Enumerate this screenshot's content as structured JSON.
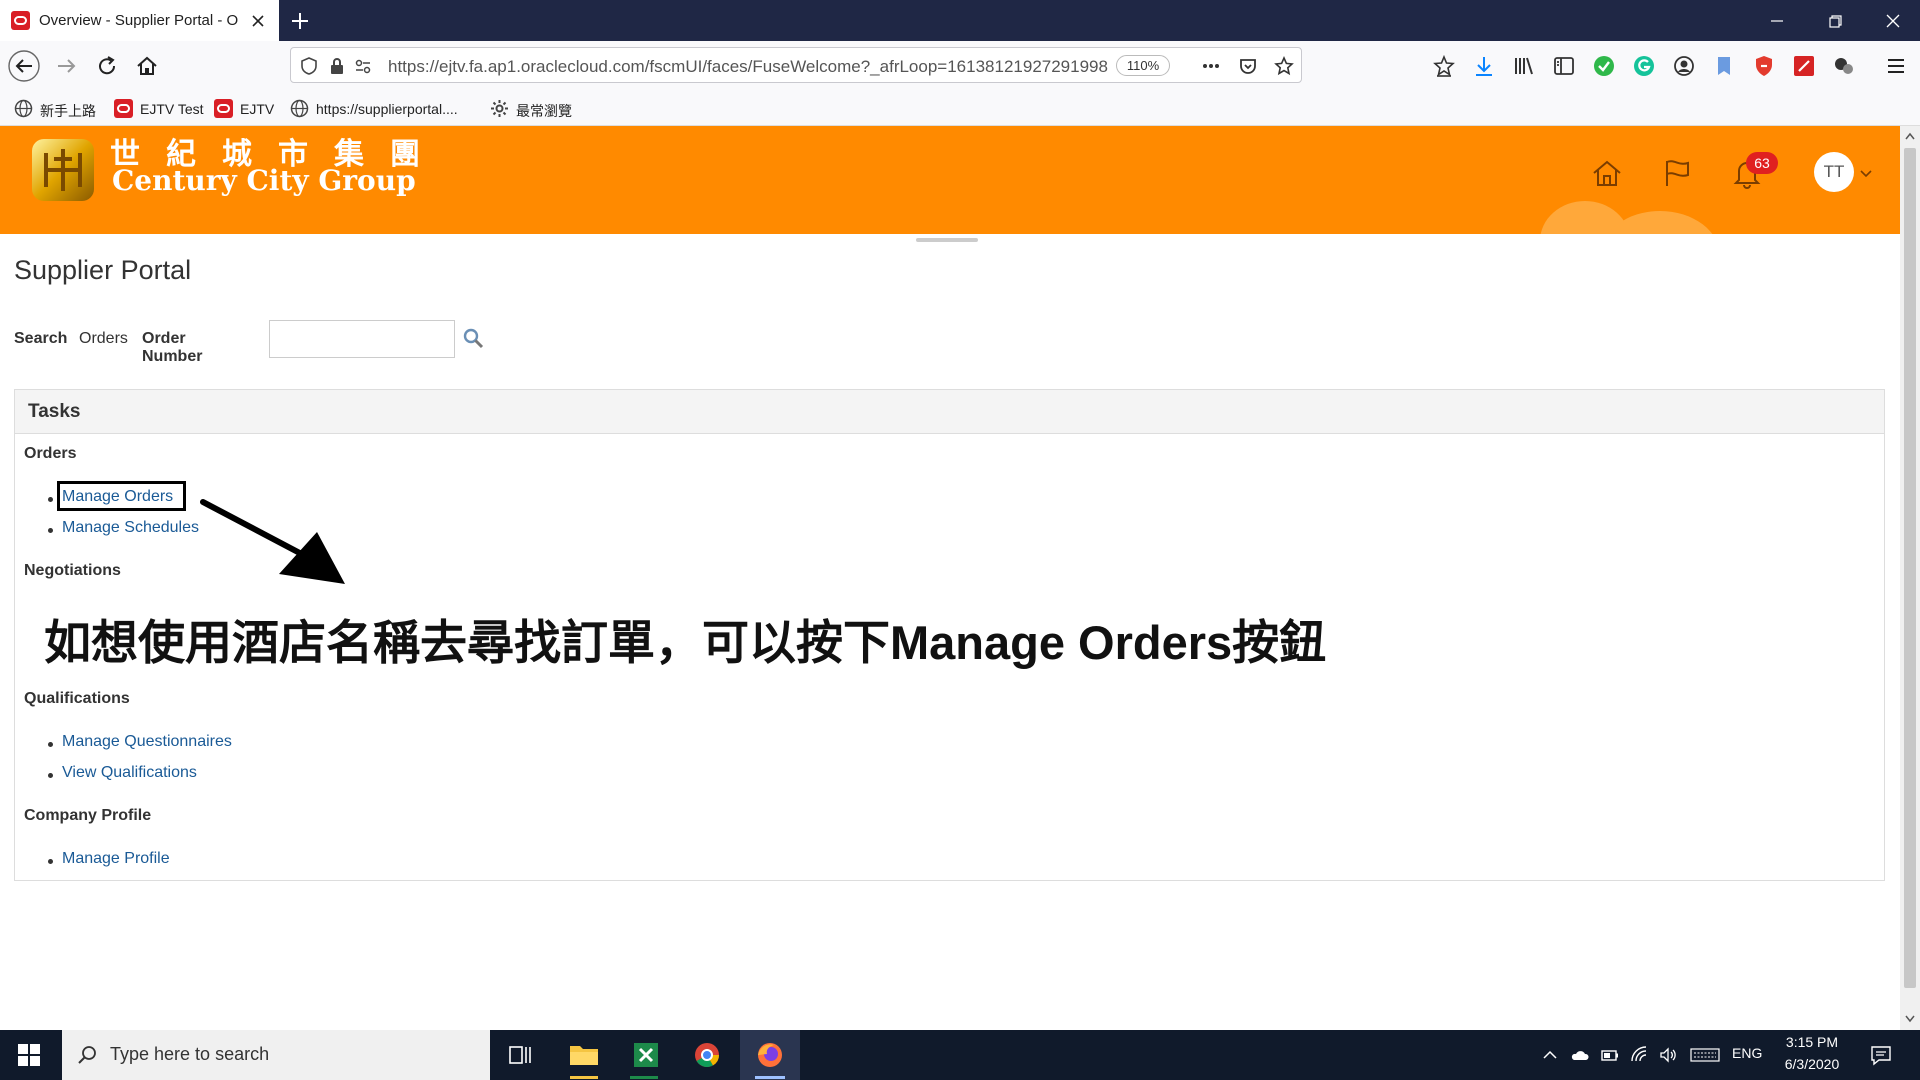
{
  "browser": {
    "tab_title": "Overview - Supplier Portal - Or",
    "url": "https://ejtv.fa.ap1.oraclecloud.com/fscmUI/faces/FuseWelcome?_afrLoop=16138121927291998",
    "zoom": "110%",
    "bookmarks": [
      {
        "label": "新手上路",
        "icon": "globe-icon"
      },
      {
        "label": "EJTV Test",
        "icon": "oracle-icon"
      },
      {
        "label": "EJTV",
        "icon": "oracle-icon"
      },
      {
        "label": "https://supplierportal....",
        "icon": "globe-icon"
      },
      {
        "label": "最常瀏覽",
        "icon": "gear-icon"
      }
    ]
  },
  "app": {
    "brand_cn": "世紀城市集團",
    "brand_en": "Century City Group",
    "notification_count": "63",
    "avatar_initials": "TT",
    "header_color": "#ff8a00"
  },
  "main": {
    "page_title": "Supplier Portal",
    "search": {
      "label": "Search",
      "scope": "Orders",
      "field": "Order Number",
      "value": ""
    },
    "tasks": {
      "title": "Tasks",
      "sections": [
        {
          "title": "Orders",
          "items": [
            "Manage Orders",
            "Manage Schedules"
          ]
        },
        {
          "title": "Negotiations",
          "items": []
        },
        {
          "title": "Qualifications",
          "items": [
            "Manage Questionnaires",
            "View Qualifications"
          ]
        },
        {
          "title": "Company Profile",
          "items": [
            "Manage Profile"
          ]
        }
      ]
    }
  },
  "annotation": {
    "text": "如想使用酒店名稱去尋找訂單，可以按下Manage Orders按鈕"
  },
  "taskbar": {
    "search_placeholder": "Type here to search",
    "language": "ENG",
    "time": "3:15 PM",
    "date": "6/3/2020"
  }
}
